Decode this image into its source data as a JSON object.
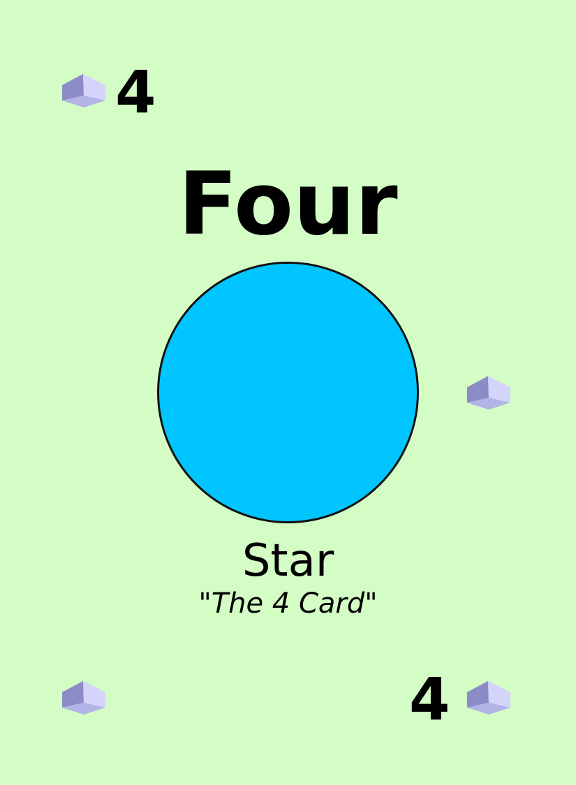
{
  "card": {
    "rank": "4",
    "title": "Four",
    "name": "Star",
    "subtitle_quote_open": "\"",
    "subtitle_text": "The 4 Card",
    "subtitle_quote_close": "\"",
    "colors": {
      "background": "#d3fdc5",
      "circle_fill": "#00c5ff",
      "circle_stroke": "#111111",
      "gem_top": "#d9d9ff",
      "gem_left": "#8888c4",
      "gem_right": "#b1b1e6",
      "gem_front": "#b5b5e8"
    },
    "icons": {
      "corner_symbol": "gem-icon",
      "center_symbol": "circle-icon"
    }
  }
}
